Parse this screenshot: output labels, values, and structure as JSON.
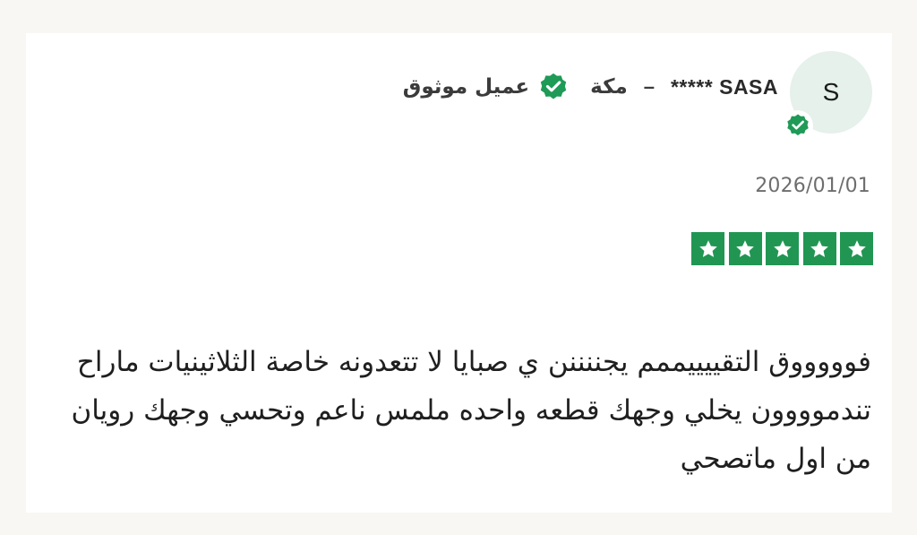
{
  "review": {
    "avatar_letter": "S",
    "reviewer_name": "***** SASA",
    "separator": "–",
    "city": "مكة",
    "verified_label": "عميل موثوق",
    "date": "2026/01/01",
    "rating": 5,
    "text": "فوووووق التقييييممم يجننننن ي صبايا لا تتعدونه خاصة الثلاثينيات ماراح تندموووون يخلي وجهك قطعه واحده ملمس ناعم وتحسي وجهك رويان من اول ماتصحي",
    "star_color": "#219653",
    "verified_color": "#1f9a57"
  }
}
